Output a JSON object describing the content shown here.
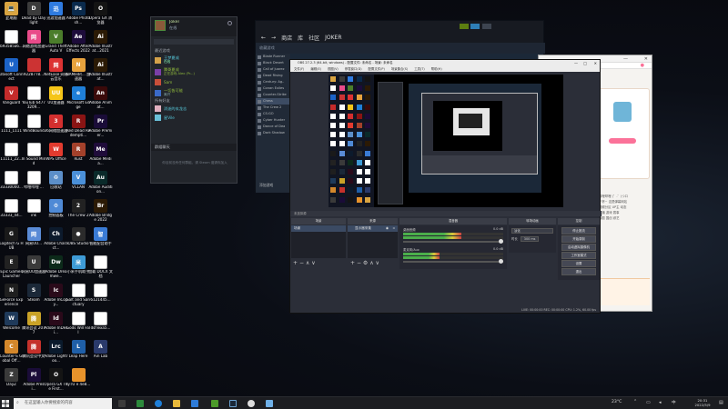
{
  "desktop": {
    "icons": [
      {
        "label": "此电脑",
        "color": "#d9a441",
        "glyph": "💻"
      },
      {
        "label": "Dead by Daylight",
        "color": "#3b3b3b",
        "glyph": "D"
      },
      {
        "label": "迅游加速器",
        "color": "#2f7be0",
        "glyph": "迅"
      },
      {
        "label": "Adobe Photosh...",
        "color": "#0a2a4c",
        "glyph": "Ps"
      },
      {
        "label": "Opera GX 浏览器",
        "color": "#141414",
        "glyph": "O"
      },
      {
        "label": "b93585a6...",
        "color": "#ffffff",
        "glyph": ""
      },
      {
        "label": "网络游戏加速器",
        "color": "#e94b8a",
        "glyph": "网"
      },
      {
        "label": "Grand Theft Auto V",
        "color": "#4b7d2b",
        "glyph": "V"
      },
      {
        "label": "Adobe After Effects 2022",
        "color": "#1d0c3a",
        "glyph": "Ae"
      },
      {
        "label": "Adobe Illustrat...2021",
        "color": "#2b1a05",
        "glyph": "Ai"
      },
      {
        "label": "Ubisoft Connect",
        "color": "#1c63c7",
        "glyph": "U"
      },
      {
        "label": "9228778...",
        "color": "#c33",
        "glyph": ""
      },
      {
        "label": "NetEase 网易云音乐",
        "color": "#d33",
        "glyph": "网"
      },
      {
        "label": "NAMedit... 加速器",
        "color": "#e7a23d",
        "glyph": "N"
      },
      {
        "label": "Adobe Illustrat...",
        "color": "#2b1a05",
        "glyph": "Ai"
      },
      {
        "label": "Vanguard",
        "color": "#c42b2b",
        "glyph": "V"
      },
      {
        "label": "YouTub 64773209...",
        "color": "#ffffff",
        "glyph": ""
      },
      {
        "label": "UU加速器",
        "color": "#f5c518",
        "glyph": "UU"
      },
      {
        "label": "Microsoft Edge",
        "color": "#1f7fd8",
        "glyph": "e"
      },
      {
        "label": "Adobe Animat...",
        "color": "#3a0a0a",
        "glyph": "An"
      },
      {
        "label": "1111_1111",
        "color": "#ffffff",
        "glyph": ""
      },
      {
        "label": "WindBound",
        "color": "#ffffff",
        "glyph": ""
      },
      {
        "label": "36网络加速器",
        "color": "#d32f2f",
        "glyph": "3"
      },
      {
        "label": "Red Dead Redempti...",
        "color": "#8a1414",
        "glyph": "R"
      },
      {
        "label": "Adobe Premier...",
        "color": "#1a0c38",
        "glyph": "Pr"
      },
      {
        "label": "11111_22...",
        "color": "#ffffff",
        "glyph": ""
      },
      {
        "label": "In Sound Mind",
        "color": "#ffffff",
        "glyph": ""
      },
      {
        "label": "WPS Office",
        "color": "#e23b2f",
        "glyph": "W"
      },
      {
        "label": "Rust",
        "color": "#a3412b",
        "glyph": "R"
      },
      {
        "label": "Adobe Media...",
        "color": "#1f0c3a",
        "glyph": "Me"
      },
      {
        "label": "33330000...",
        "color": "#ffffff",
        "glyph": ""
      },
      {
        "label": "哔哩哔哩 ...",
        "color": "#ffffff",
        "glyph": ""
      },
      {
        "label": "回收站",
        "color": "#5c8fc9",
        "glyph": "♻"
      },
      {
        "label": "VCLAN",
        "color": "#4a90d9",
        "glyph": "V"
      },
      {
        "label": "Adobe Audition...",
        "color": "#0a2a2a",
        "glyph": "Au"
      },
      {
        "label": "33333_44...",
        "color": "#ffffff",
        "glyph": ""
      },
      {
        "label": "ink",
        "color": "#ffffff",
        "glyph": ""
      },
      {
        "label": "控制面板",
        "color": "#4f8ad6",
        "glyph": "⚙"
      },
      {
        "label": "The Crew 2",
        "color": "#222",
        "glyph": "2"
      },
      {
        "label": "Adobe Bridge 2022",
        "color": "#2b1a05",
        "glyph": "Br"
      },
      {
        "label": "Logitech G HUB",
        "color": "#1a1a1a",
        "glyph": "G"
      },
      {
        "label": "网易UU...",
        "color": "#5a8bd6",
        "glyph": "网"
      },
      {
        "label": "Adobe Charact...",
        "color": "#0c1a2c",
        "glyph": "Ch"
      },
      {
        "label": "OBS Studio",
        "color": "#2b2b2b",
        "glyph": "●"
      },
      {
        "label": "智能配音助手",
        "color": "#3a7bd5",
        "glyph": "智"
      },
      {
        "label": "Epic Games Launcher",
        "color": "#222",
        "glyph": "E"
      },
      {
        "label": "网易UU加速器",
        "color": "#3a3a3a",
        "glyph": "U"
      },
      {
        "label": "Adobe Dreamwe...",
        "color": "#0c2a1a",
        "glyph": "Dw"
      },
      {
        "label": "小米手机助手",
        "color": "#3e9bd6",
        "glyph": "米"
      },
      {
        "label": "加载 DOCX 文档",
        "color": "#ffffff",
        "glyph": ""
      },
      {
        "label": "GeForce Experience",
        "color": "#1f1f1f",
        "glyph": "N"
      },
      {
        "label": "Steam",
        "color": "#1b2838",
        "glyph": "S"
      },
      {
        "label": "Adobe InCopy...",
        "color": "#2a0a1a",
        "glyph": "Ic"
      },
      {
        "label": "Salt and Sanctuary",
        "color": "#ffffff",
        "glyph": ""
      },
      {
        "label": "6121445...",
        "color": "#ffffff",
        "glyph": ""
      },
      {
        "label": "Welcome",
        "color": "#1f3a5a",
        "glyph": "W"
      },
      {
        "label": "腾讯会议 2077",
        "color": "#c9a227",
        "glyph": "腾"
      },
      {
        "label": "Adobe InDesi...",
        "color": "#2a0a1a",
        "glyph": "Id"
      },
      {
        "label": "Gods Will Fall",
        "color": "#ffffff",
        "glyph": ""
      },
      {
        "label": "dsfTexa5...",
        "color": "#ffffff",
        "glyph": ""
      },
      {
        "label": "Counter-S Global Off...",
        "color": "#d4872b",
        "glyph": "C"
      },
      {
        "label": "腾讯会议中文",
        "color": "#c5312b",
        "glyph": "腾"
      },
      {
        "label": "Adobe Lightroo...",
        "color": "#0a1a2c",
        "glyph": "Lrc"
      },
      {
        "label": "Leap Here",
        "color": "#1f5fa8",
        "glyph": "L"
      },
      {
        "label": "Ain Lab",
        "color": "#2a3a6b",
        "glyph": "A"
      },
      {
        "label": "DayZ",
        "color": "#3a3a3a",
        "glyph": "Z"
      },
      {
        "label": "Adobe Presi...",
        "color": "#1a0c38",
        "glyph": "Pl"
      },
      {
        "label": "Opera GX The First...",
        "color": "#141414",
        "glyph": "O"
      },
      {
        "label": "ryTU e 4e8...",
        "color": "#e8932b",
        "glyph": ""
      }
    ]
  },
  "friends": {
    "username": "Joker",
    "status": "在线",
    "search_placeholder": "",
    "group_label": "最近游戏",
    "entries": [
      {
        "name": "王梦夏成",
        "sub": "在线"
      },
      {
        "name": "腾哥夏成",
        "sub": "正在游戏 Alex (Pr...)"
      },
      {
        "name": "Sam",
        "sub": ""
      },
      {
        "name": "一切皆可能",
        "sub": "离开"
      }
    ],
    "section_label": "所有好友",
    "friend_rows": [
      {
        "name": "消逝的玄龙志",
        "sub": ""
      },
      {
        "name": "星Vile",
        "sub": ""
      }
    ],
    "chat_label": "群组聊天",
    "empty_text": "你目前没有任何群组。请 Steam 邀请你加入"
  },
  "steam": {
    "nav": [
      "←",
      "→",
      "商店",
      "库",
      "社区",
      "JOKER"
    ],
    "library_label": "收藏游戏",
    "games": [
      "Blade Runner",
      "Black Desert",
      "Call of Juarez",
      "Dead Rising",
      "Century: Ag..",
      "Conan Exiles",
      "Counter-Strike",
      "Chess",
      "The Crew 2",
      "CS:GO",
      "Cyber Hunter",
      "Dance of Dea",
      "Dark Shadow"
    ],
    "add_label": "添加游戏"
  },
  "browser": {
    "tab": "哔哩哔哩",
    "text_rows": [
      "哔哩哔哩 (゜-゜)つロ",
      "干杯~ 这是弹幕网站",
      "视频分区 UP主 动态",
      "直播 游戏 赛事",
      "番剧 国创 综艺"
    ]
  },
  "obs": {
    "title": "OBS 27.2.3 (64-bit, windows) - 配置文件: 未命名 - 场景: 未命名",
    "menu": [
      "文件(F)",
      "编辑(E)",
      "视图(V)",
      "停靠窗口(D)",
      "配置文件(P)",
      "场景集合(S)",
      "工具(T)",
      "帮助(H)"
    ],
    "source_label": "未选择源",
    "docks": {
      "scenes": "场景",
      "sources": "来源",
      "mixer": "混音器",
      "transitions": "转场动画",
      "controls": "控制"
    },
    "scene_item": "场景",
    "source_item": "显示器采集",
    "mixer": [
      {
        "name": "桌面音频",
        "db": "0.0 dB",
        "level": 0.58
      },
      {
        "name": "麦克风/Aux",
        "db": "0.0 dB",
        "level": 0.36
      }
    ],
    "transition": {
      "type": "淡化",
      "duration_label": "时长",
      "duration": "300 ms"
    },
    "controls": [
      "停止推流",
      "开始录制",
      "启动虚拟摄像机",
      "工作室模式",
      "设置",
      "退出"
    ],
    "status": "LIVE: 00:00:00   REC: 00:00:00   CPU: 1.2%, 60.00 fps"
  },
  "taskbar": {
    "search_placeholder": "在这里输入你要搜索的内容",
    "weather": "23°C",
    "time": "20:31",
    "date": "2022/5/9"
  }
}
